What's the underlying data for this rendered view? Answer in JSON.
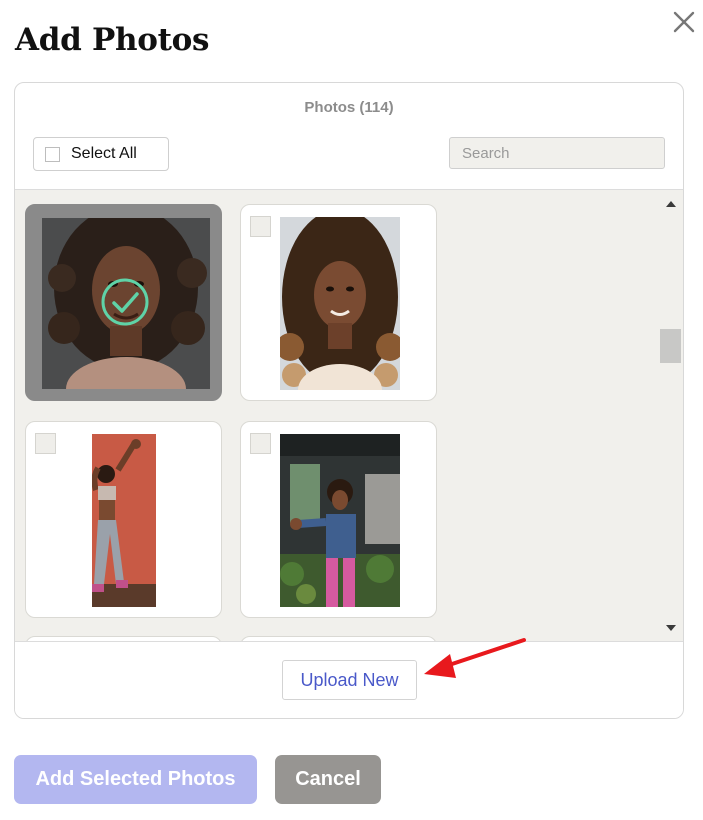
{
  "dialog": {
    "title": "Add Photos"
  },
  "header": {
    "photos_count": "Photos (114)",
    "select_all_label": "Select All",
    "search_placeholder": "Search",
    "search_value": ""
  },
  "photos": [
    {
      "name": "photo-1",
      "selected": true
    },
    {
      "name": "photo-2",
      "selected": false
    },
    {
      "name": "photo-3",
      "selected": false
    },
    {
      "name": "photo-4",
      "selected": false
    }
  ],
  "footer": {
    "upload_label": "Upload New"
  },
  "actions": {
    "add_selected_label": "Add Selected Photos",
    "cancel_label": "Cancel"
  },
  "colors": {
    "accent": "#4a59c9",
    "primary_disabled": "#b3b7f0",
    "check": "#5fd3a7",
    "annotation_arrow": "#e8191d"
  },
  "icons": [
    "close-icon",
    "checkmark-icon",
    "scroll-up-icon",
    "scroll-down-icon",
    "arrow-annotation"
  ]
}
